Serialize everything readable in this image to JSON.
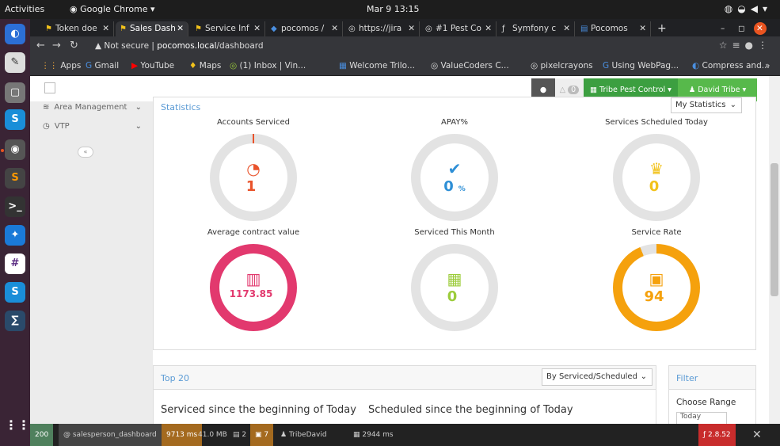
{
  "os": {
    "activities": "Activities",
    "app_name": "Google Chrome ▾",
    "clock": "Mar 9  13:15"
  },
  "tabs": [
    {
      "label": "Token doe",
      "icon": "token-icon"
    },
    {
      "label": "Sales Dash",
      "icon": "token-icon",
      "active": true
    },
    {
      "label": "Service Inf",
      "icon": "token-icon"
    },
    {
      "label": "pocomos /",
      "icon": "vscode-icon"
    },
    {
      "label": "https://jira",
      "icon": "globe-icon"
    },
    {
      "label": "#1 Pest Co",
      "icon": "globe-icon"
    },
    {
      "label": "Symfony c",
      "icon": "symfony-icon"
    },
    {
      "label": "Pocomos",
      "icon": "doc-icon"
    }
  ],
  "address": {
    "not_secure": "Not secure",
    "host": "pocomos.local",
    "path": "/dashboard"
  },
  "bookmarks": [
    "Apps",
    "Gmail",
    "YouTube",
    "Maps",
    "(1) Inbox | Vin...",
    "Welcome Trilo...",
    "ValueCoders C...",
    "pixelcrayons",
    "Using WebPag...",
    "Compress and..."
  ],
  "header": {
    "chat_icon": "chat-icon",
    "notif_count": "0",
    "office": "Tribe Pest Control",
    "user": "David Tribe"
  },
  "sidebar": {
    "items": [
      {
        "label": "Area Management",
        "icon": "layers-icon"
      },
      {
        "label": "VTP",
        "icon": "clock-icon"
      }
    ],
    "collapse_label": "«"
  },
  "stats": {
    "title": "Statistics",
    "select_value": "My Statistics",
    "gauges": [
      {
        "label": "Accounts Serviced",
        "value": "1",
        "unit": "",
        "icon": "speedometer-icon",
        "color": "#e9532b",
        "fill": 0.0
      },
      {
        "label": "APAY%",
        "value": "0",
        "unit": "%",
        "icon": "check-icon",
        "color": "#2e8fd6",
        "fill": 0.0
      },
      {
        "label": "Services Scheduled Today",
        "value": "0",
        "unit": "",
        "icon": "trophy-icon",
        "color": "#f2c21b",
        "fill": 0.0
      },
      {
        "label": "Average contract value",
        "value": "1173.85",
        "unit": "",
        "icon": "chart-icon",
        "color": "#e2396e",
        "fill": 1.0
      },
      {
        "label": "Serviced This Month",
        "value": "0",
        "unit": "",
        "icon": "calendar-icon",
        "color": "#9ccc3b",
        "fill": 0.0
      },
      {
        "label": "Service Rate",
        "value": "94",
        "unit": "",
        "icon": "money-icon",
        "color": "#f5a10d",
        "fill": 0.94
      }
    ]
  },
  "top20": {
    "title": "Top 20",
    "select_value": "By Serviced/Scheduled",
    "col1": "Serviced since the beginning of Today",
    "col2": "Scheduled since the beginning of Today"
  },
  "filter": {
    "title": "Filter",
    "choose_range": "Choose Range",
    "range_value": "Today"
  },
  "debug": {
    "status": "200",
    "route": "@ salesperson_dashboard",
    "time": "9713 ms",
    "memory": "41.0 MB",
    "forms": "2",
    "queries": "7",
    "user": "TribeDavid",
    "ajax": "2944 ms",
    "version": "2.8.52"
  }
}
